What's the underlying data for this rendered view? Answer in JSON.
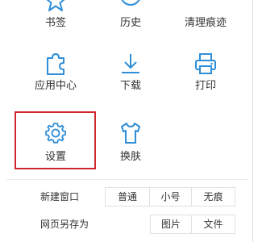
{
  "menu": {
    "row1": [
      {
        "label": "书签",
        "icon": "star-icon"
      },
      {
        "label": "历史",
        "icon": "history-icon"
      },
      {
        "label": "清理痕迹",
        "icon": "clear-traces-icon"
      }
    ],
    "row2": [
      {
        "label": "应用中心",
        "icon": "puzzle-icon"
      },
      {
        "label": "下载",
        "icon": "download-icon"
      },
      {
        "label": "打印",
        "icon": "printer-icon"
      }
    ],
    "row3": [
      {
        "label": "设置",
        "icon": "gear-icon"
      },
      {
        "label": "换肤",
        "icon": "shirt-icon"
      }
    ]
  },
  "new_window": {
    "label": "新建窗口",
    "options": [
      "普通",
      "小号",
      "无痕"
    ]
  },
  "save_page": {
    "label": "网页另存为",
    "options": [
      "图片",
      "文件"
    ]
  },
  "colors": {
    "icon": "#2f8ed8",
    "highlight": "#d0282e",
    "text": "#333333"
  }
}
